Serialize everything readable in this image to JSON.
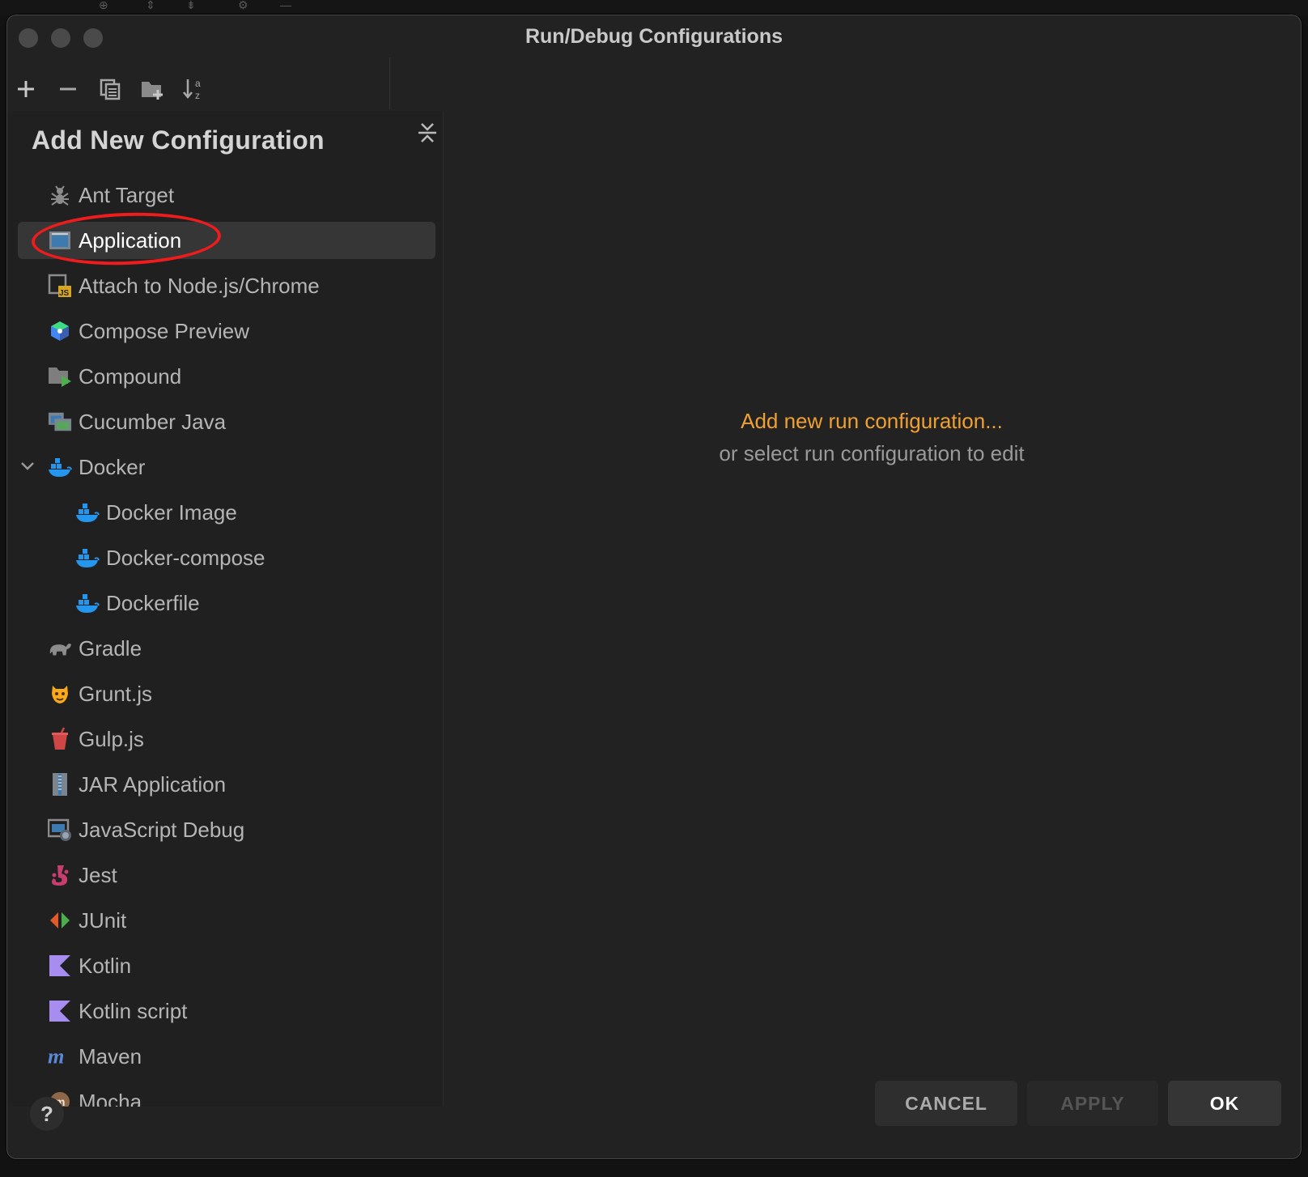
{
  "window": {
    "title": "Run/Debug Configurations"
  },
  "toolbar": {
    "add_icon": "plus-icon",
    "remove_icon": "minus-icon",
    "copy_icon": "copy-icon",
    "new_folder_icon": "folder-plus-icon",
    "sort_icon": "sort-az-icon",
    "collapse_icon": "collapse-all-icon"
  },
  "left_panel": {
    "heading": "Add New Configuration",
    "items": [
      {
        "label": "Ant Target",
        "icon": "ant-icon",
        "level": 0
      },
      {
        "label": "Application",
        "icon": "application-window-icon",
        "level": 0,
        "selected": true
      },
      {
        "label": "Attach to Node.js/Chrome",
        "icon": "attach-js-icon",
        "level": 0
      },
      {
        "label": "Compose Preview",
        "icon": "compose-cube-icon",
        "level": 0
      },
      {
        "label": "Compound",
        "icon": "compound-folder-run-icon",
        "level": 0
      },
      {
        "label": "Cucumber Java",
        "icon": "cucumber-java-icon",
        "level": 0
      },
      {
        "label": "Docker",
        "icon": "docker-whale-icon",
        "level": 0,
        "expanded": true
      },
      {
        "label": "Docker Image",
        "icon": "docker-whale-icon",
        "level": 1
      },
      {
        "label": "Docker-compose",
        "icon": "docker-whale-icon",
        "level": 1
      },
      {
        "label": "Dockerfile",
        "icon": "docker-whale-icon",
        "level": 1
      },
      {
        "label": "Gradle",
        "icon": "gradle-elephant-icon",
        "level": 0
      },
      {
        "label": "Grunt.js",
        "icon": "grunt-boar-icon",
        "level": 0
      },
      {
        "label": "Gulp.js",
        "icon": "gulp-cup-icon",
        "level": 0
      },
      {
        "label": "JAR Application",
        "icon": "jar-zip-icon",
        "level": 0
      },
      {
        "label": "JavaScript Debug",
        "icon": "javascript-debug-icon",
        "level": 0
      },
      {
        "label": "Jest",
        "icon": "jest-icon",
        "level": 0
      },
      {
        "label": "JUnit",
        "icon": "junit-icon",
        "level": 0
      },
      {
        "label": "Kotlin",
        "icon": "kotlin-icon",
        "level": 0
      },
      {
        "label": "Kotlin script",
        "icon": "kotlin-icon",
        "level": 0
      },
      {
        "label": "Maven",
        "icon": "maven-m-icon",
        "level": 0
      },
      {
        "label": "Mocha",
        "icon": "mocha-icon",
        "level": 0
      }
    ]
  },
  "right_panel": {
    "link_text": "Add new run configuration...",
    "hint_text": "or select run configuration to edit"
  },
  "footer": {
    "help_label": "?",
    "cancel_label": "CANCEL",
    "apply_label": "APPLY",
    "ok_label": "OK"
  },
  "colors": {
    "window_bg": "#222222",
    "panel_bg": "#202020",
    "selected_bg": "#363636",
    "link_orange": "#f0a030",
    "annotation_red": "#ee1c1c"
  }
}
